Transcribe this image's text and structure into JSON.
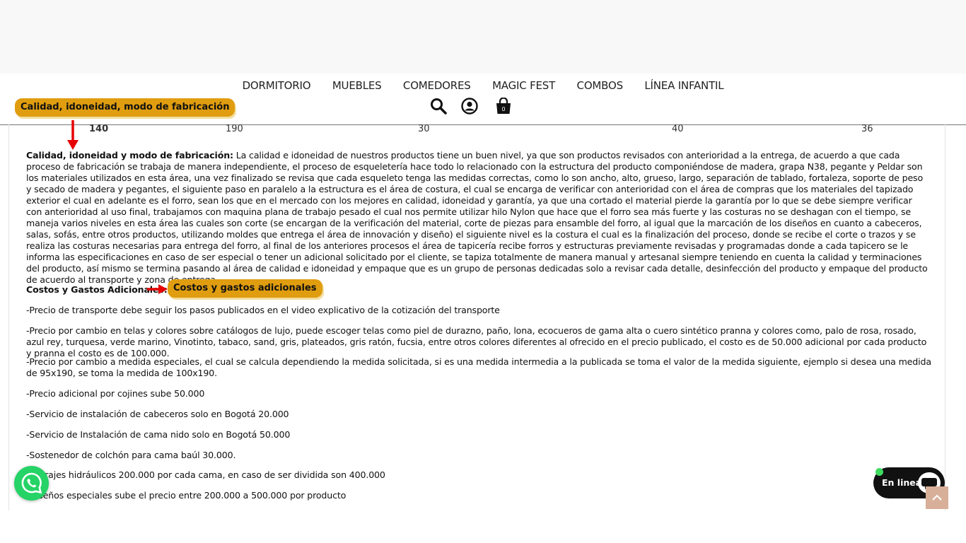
{
  "nav": {
    "menu": [
      "DORMITORIO",
      "MUEBLES",
      "COMEDORES",
      "MAGIC FEST",
      "COMBOS",
      "LÍNEA INFANTIL"
    ]
  },
  "annotations": {
    "quality_badge": "Calidad, idoneidad,  modo de fabricación",
    "costs_badge": "Costos y  gastos adicionales"
  },
  "table_values": [
    "140",
    "190",
    "30",
    "40",
    "36"
  ],
  "article": {
    "quality_heading": "Calidad, idoneidad y modo de fabricación:",
    "quality_text": " La calidad e idoneidad de nuestros productos tiene un buen nivel, ya que son productos revisados con anterioridad a la entrega, de acuerdo a que cada proceso de fabricación se trabaja de manera independiente, el proceso de esqueletería hace todo lo relacionado con la estructura del producto componiéndose de madera, grapa N38, pegante y Peldar son los materiales utilizados en esta área, una vez finalizado se revisa que cada esqueleto tenga las medidas correctas, como lo son ancho, alto, grueso, largo, separación de tablado, fortaleza, soporte de peso y secado de madera y pegantes, el siguiente paso en paralelo a la estructura es el área de costura, el cual se encarga de verificar con anterioridad con el área de compras que los materiales del tapizado exterior el cual en adelante es el forro, sean los que en el mercado con los mejores en calidad, idoneidad y garantía, ya que una cortado el material pierde la garantía por lo que se debe siempre verificar con anterioridad al uso final, trabajamos con maquina plana de trabajo pesado el cual nos permite utilizar hilo Nylon que hace que el forro sea más fuerte y las costuras no se deshagan con el tiempo, se maneja varios niveles en esta área las cuales son corte (se encargan de la verificación del material, corte de piezas para ensamble del forro, al igual que la marcación de los diseños en cuanto a cabeceros, salas, sofás, entre otros productos, utilizando moldes que entrega el área de innovación y diseño) el siguiente nivel es la costura el cual es la finalización del proceso, donde se recibe el corte o trazos y se realiza las costuras necesarias para entrega del forro, al final de los anteriores procesos el área de tapicería recibe forros y estructuras previamente revisadas y programadas donde a cada tapicero se le informa las especificaciones en caso de ser especial o tener un adicional solicitado por el cliente, se tapiza totalmente de manera manual y artesanal siempre teniendo en cuenta la calidad y terminaciones del producto, así mismo se termina pasando al área de calidad e idoneidad y empaque que es un grupo de personas dedicadas solo a revisar cada detalle, desinfección del producto y empaque del producto de acuerdo al transporte y zona de entrega.",
    "costs_heading": "Costos y Gastos Adicionales:",
    "lines": [
      "-Precio de transporte debe seguir los pasos publicados en el video explicativo de la cotización del transporte",
      "-Precio por cambio en telas y colores sobre catálogos de lujo, puede escoger telas como piel de durazno, paño, lona, ecocueros de gama alta o cuero sintético pranna y colores como, palo de rosa, rosado, azul rey, turquesa, verde marino, Vinotinto, tabaco, sand, gris, plateados, gris ratón, fucsia, entre otros colores diferentes al ofrecido en el precio publicado, el costo es de 50.000 adicional por cada producto y pranna el costo es de 100.000.",
      "-Precio por cambio a medida especiales, el cual se calcula dependiendo la medida solicitada, si es una medida intermedia a la publicada se toma el valor de la medida siguiente, ejemplo si desea una medida de 95x190, se toma la medida de 100x190.",
      "-Precio adicional por cojines sube 50.000",
      "-Servicio de instalación de cabeceros solo en Bogotá 20.000",
      "-Servicio de Instalación de cama nido solo en Bogotá 50.000",
      "-Sostenedor de colchón para cama baúl 30.000.",
      "-Herrajes hidráulicos 200.000 por cada cama, en caso de ser dividida son 400.000",
      "-Diseños especiales sube el precio entre 200.000 a 500.000 por producto"
    ]
  },
  "chat": {
    "label": "En linea"
  }
}
